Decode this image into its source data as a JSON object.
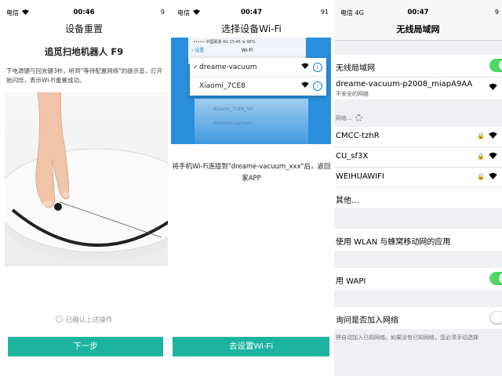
{
  "panel1": {
    "status": {
      "carrier": "电信",
      "time": "00:46",
      "battery": "9"
    },
    "title": "设备重置",
    "heading": "追觅扫地机器人 F9",
    "description": "下电源键与回充键3秒，听到\"等待配置网络\"的提示音，灯开始闪烁，表示Wi-Fi重置成功。",
    "confirm_label": "已确认上述操作",
    "next_button": "下一步"
  },
  "panel2": {
    "status": {
      "carrier": "电信",
      "time": "00:47",
      "battery": "91"
    },
    "title": "选择设备Wi-Fi",
    "illustration": {
      "phone_status": "••••• 中国联通  4G   15:46   ⊕ 98%",
      "back_label": "设置",
      "screen_title": "Wi-Fi",
      "networks": [
        "dreame-vacuum",
        "Xiaomi_7CE8"
      ],
      "faded_networks": [
        "Xiaomi_7CE8_5G",
        "dreame-vacuum"
      ]
    },
    "instruction_line1": "将手机Wi-Fi连接到\"dreame-vacuum_xxx\"后，返回",
    "instruction_line2": "家APP",
    "goto_button": "去设置Wi-Fi"
  },
  "panel3": {
    "status": {
      "carrier": "电信",
      "network": "4G",
      "time": "00:47",
      "battery": "9"
    },
    "title": "无线局域网",
    "wlan_label": "无线局域网",
    "connected": {
      "name": "dreame-vacuum-p2008_miapA9AA",
      "subtitle": "不安全的网络"
    },
    "section_header": "网络...",
    "networks": [
      {
        "name": "CMCC-tzhR",
        "locked": true
      },
      {
        "name": "CU_sf3X",
        "locked": true
      },
      {
        "name": "WEIHUAWIFI",
        "locked": true
      }
    ],
    "other_label": "其他...",
    "apps_label": "使用 WLAN 与蜂窝移动网的应用",
    "wapi_label": "用 WAPI",
    "ask_label": "询问是否加入网络",
    "footnote": "将自动加入已知网络。如果没有已知网络，您必须手动选择"
  },
  "colors": {
    "primary": "#1cb4a0",
    "toggle_on": "#4cd964",
    "ios_blue": "#1b7fd6"
  }
}
